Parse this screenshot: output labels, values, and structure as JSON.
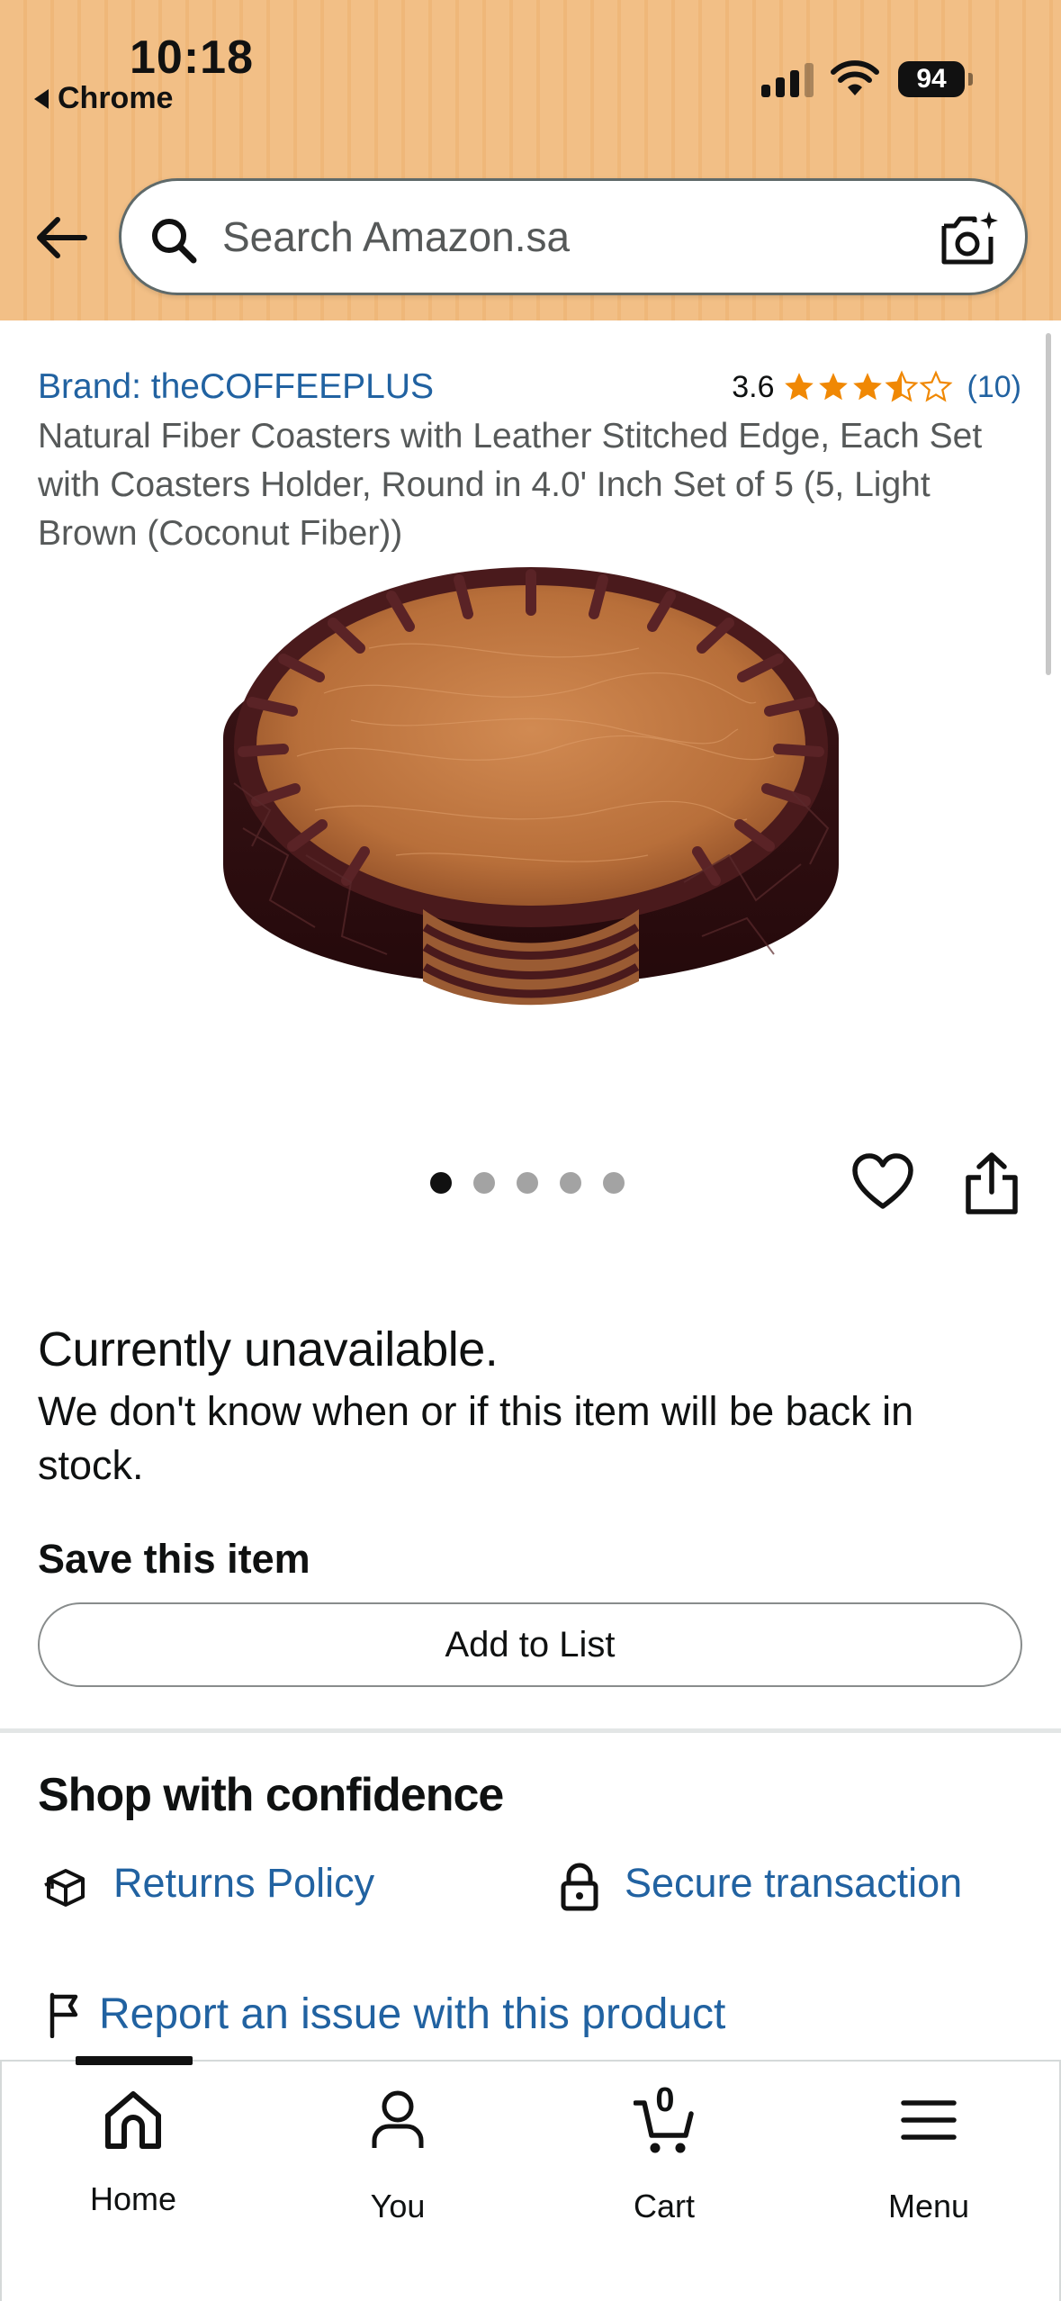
{
  "status_bar": {
    "time": "10:18",
    "back_app": "Chrome",
    "battery": "94"
  },
  "search": {
    "placeholder": "Search Amazon.sa",
    "value": ""
  },
  "product": {
    "brand": "Brand: theCOFFEEPLUS",
    "rating": "3.6",
    "rating_stars": 3.5,
    "rating_count": "(10)",
    "title": "Natural Fiber Coasters with Leather Stitched Edge, Each Set with Coasters Holder, Round in 4.0' Inch Set of 5 (5, Light Brown (Coconut Fiber))",
    "image_count": 5,
    "active_image": 0
  },
  "availability": {
    "heading": "Currently unavailable.",
    "message": "We don't know when or if this item will be back in stock.",
    "save_label": "Save this item",
    "add_to_list": "Add to List"
  },
  "confidence": {
    "heading": "Shop with confidence",
    "returns": "Returns Policy",
    "secure": "Secure transaction",
    "report": "Report an issue with this product"
  },
  "nav": {
    "home": "Home",
    "you": "You",
    "cart": "Cart",
    "cart_count": "0",
    "menu": "Menu"
  },
  "colors": {
    "header_bg": "#f2bf86",
    "link": "#2162a1",
    "star": "#f08804",
    "text": "#0f1111"
  },
  "icons": [
    "back-arrow-icon",
    "search-icon",
    "camera-icon",
    "star-icon",
    "heart-icon",
    "share-icon",
    "returns-box-icon",
    "lock-icon",
    "flag-icon",
    "home-icon",
    "user-icon",
    "cart-icon",
    "menu-icon"
  ]
}
